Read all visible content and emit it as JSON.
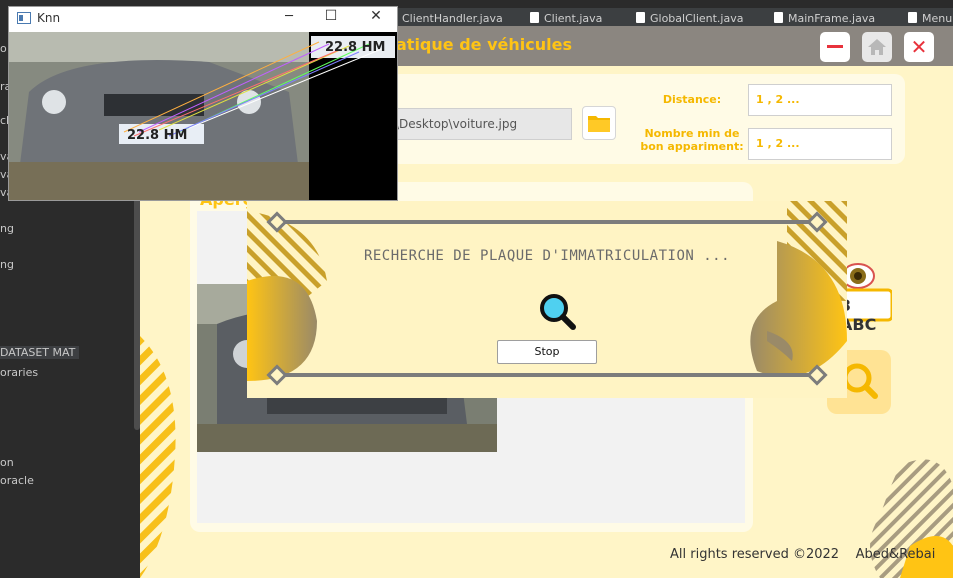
{
  "ide": {
    "tabs": [
      "ClientHandler.java",
      "Client.java",
      "GlobalClient.java",
      "MainFrame.java",
      "Menu"
    ],
    "left_items": [
      "o",
      "ra",
      "ck",
      "va",
      "va",
      "va",
      "ng",
      "ng",
      "DATASET MAT",
      "oraries",
      "on",
      "oracle"
    ]
  },
  "knn_window": {
    "title": "Knn",
    "controls": [
      "minimize",
      "maximize",
      "close"
    ],
    "plate_text": "22.8 HM"
  },
  "app": {
    "title": "atique de véhicules",
    "path_value": "\\Desktop\\voiture.jpg",
    "distance_label": "Distance:",
    "distance_value": "1 , 2 ...",
    "nombre_label_line1": "Nombre min de",
    "nombre_label_line2": "bon appariment:",
    "nombre_value": "1 , 2 ...",
    "preview_label": "Aperç",
    "plate_icon_text": "3 ABC",
    "footer_rights": "All rights reserved ©2022",
    "footer_authors": "Abed&Rebai",
    "colors": {
      "accent": "#ffc414",
      "bg": "#fff5c7",
      "titlebar": "#8b8680",
      "danger": "#e8323c"
    }
  },
  "dialog": {
    "message": "RECHERCHE DE PLAQUE D'IMMATRICULATION ...",
    "stop_label": "Stop",
    "icon": "magnifier-icon"
  }
}
